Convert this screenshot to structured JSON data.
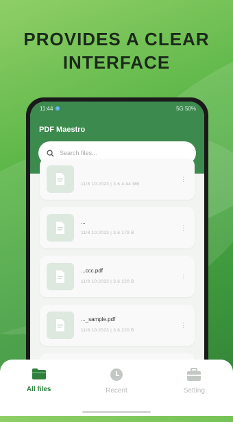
{
  "headline": {
    "line1": "PROVIDES A CLEAR",
    "line2": "INTERFACE"
  },
  "status_bar": {
    "time": "11:44",
    "right": "5G 50%"
  },
  "app": {
    "title": "PDF Maestro"
  },
  "search": {
    "placeholder": "Search files..."
  },
  "files": [
    {
      "name": "",
      "meta": "11/8 10:2023 | 3.6 4:44 MB"
    },
    {
      "name": "...",
      "meta": "11/8 10:2023 | 3.6 179 B"
    },
    {
      "name": "...ccc.pdf",
      "meta": "11/8 10:2023 | 3.6 220 B"
    },
    {
      "name": "..._sample.pdf",
      "meta": "11/8 10:2023 | 3.6 220 B"
    }
  ],
  "tabs": [
    {
      "label": "All files",
      "icon": "folder-icon",
      "active": true
    },
    {
      "label": "Recent",
      "icon": "clock-icon",
      "active": false
    },
    {
      "label": "Setting",
      "icon": "toolbox-icon",
      "active": false
    }
  ],
  "colors": {
    "brand": "#3d8a4e",
    "active_tab": "#2f7f3d",
    "bg_green": "#5cb648"
  }
}
